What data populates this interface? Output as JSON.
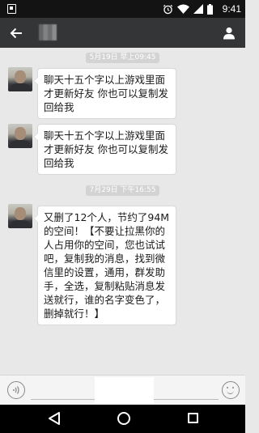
{
  "status_bar": {
    "time": "9:41",
    "icons": [
      "image-icon",
      "alarm-icon",
      "wifi-icon",
      "signal-icon",
      "battery-icon"
    ]
  },
  "header": {
    "back_icon": "arrow-left-icon",
    "profile_icon": "person-icon"
  },
  "chat": {
    "messages": [
      {
        "timestamp": "5月19日 早上09:45",
        "text": "聊天十五个字以上游戏里面才更新好友 你也可以复制发回给我"
      },
      {
        "timestamp": "",
        "text": "聊天十五个字以上游戏里面才更新好友 你也可以复制发回给我"
      },
      {
        "timestamp": "7月29日 下午16:55",
        "text": "又删了12个人，节约了94M的空间！【不要让拉黑你的人占用你的空间，您也试试吧，复制我的消息，找到微信里的设置，通用，群发助手，全选，复制粘贴消息发送就行，谁的名字变色了，删掉就行！】"
      }
    ]
  },
  "input_bar": {
    "voice_icon": "voice-icon",
    "emoji_icon": "emoji-icon"
  },
  "nav_bar": {
    "icons": [
      "back-triangle-icon",
      "home-circle-icon",
      "recents-square-icon"
    ]
  },
  "colors": {
    "status_bar": "#131313",
    "app_bar": "#333536",
    "chat_background": "#e8e8e8",
    "timestamp_background": "#d3d3d3",
    "bubble": "#ffffff"
  }
}
